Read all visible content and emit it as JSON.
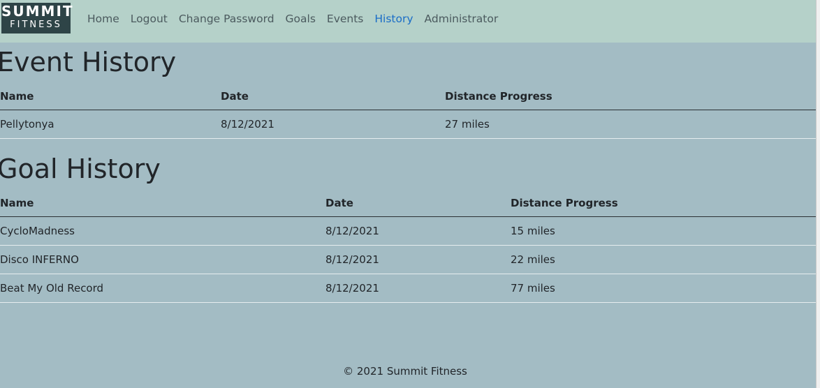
{
  "brand": {
    "logo_line1": "SUMMIT",
    "logo_line2": "FITNESS"
  },
  "nav": {
    "items": [
      {
        "label": "Home",
        "active": false
      },
      {
        "label": "Logout",
        "active": false
      },
      {
        "label": "Change Password",
        "active": false
      },
      {
        "label": "Goals",
        "active": false
      },
      {
        "label": "Events",
        "active": false
      },
      {
        "label": "History",
        "active": true
      },
      {
        "label": "Administrator",
        "active": false
      }
    ]
  },
  "event_history": {
    "title": "Event History",
    "columns": [
      "Name",
      "Date",
      "Distance Progress"
    ],
    "rows": [
      [
        "Pellytonya",
        "8/12/2021",
        "27 miles"
      ]
    ]
  },
  "goal_history": {
    "title": "Goal History",
    "columns": [
      "Name",
      "Date",
      "Distance Progress"
    ],
    "rows": [
      [
        "CycloMadness",
        "8/12/2021",
        "15 miles"
      ],
      [
        "Disco INFERNO",
        "8/12/2021",
        "22 miles"
      ],
      [
        "Beat My Old Record",
        "8/12/2021",
        "77 miles"
      ]
    ]
  },
  "footer": {
    "text": "© 2021 Summit Fitness"
  },
  "colors": {
    "navbar_bg": "#b5d1c9",
    "page_bg": "#a3bcc4",
    "logo_bg": "#2e4447",
    "active_link": "#1a6dc7"
  }
}
